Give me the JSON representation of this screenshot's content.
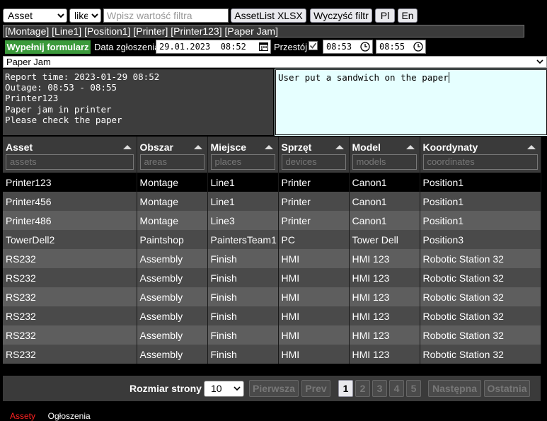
{
  "toolbar": {
    "field_select": "Asset",
    "operator_select": "like",
    "filter_placeholder": "Wpisz wartość filtra",
    "export_label": "AssetList XLSX",
    "clear_label": "Wyczyść filtr",
    "lang_pl": "Pl",
    "lang_en": "En"
  },
  "tags": "[Montage] [Line1] [Position1] [Printer] [Printer123] [Paper Jam]",
  "form": {
    "fill_label": "Wypełnij formularz",
    "date_label": "Data zgłoszenia",
    "date_value": "29.01.2023  08:52",
    "outage_label": "Przestój",
    "outage_checked": true,
    "time_from": "08:53",
    "time_to": "08:55",
    "issue_select": "Paper Jam"
  },
  "report": {
    "line1": "Report time: 2023-01-29 08:52",
    "line2": "Outage: 08:53 - 08:55",
    "line3": "Printer123",
    "line4": "Paper jam in printer",
    "line5": "Please check the paper"
  },
  "note": "User put a sandwich on the paper",
  "table": {
    "headers": [
      {
        "label": "Asset",
        "placeholder": "assets"
      },
      {
        "label": "Obszar",
        "placeholder": "areas"
      },
      {
        "label": "Miejsce",
        "placeholder": "places"
      },
      {
        "label": "Sprzęt",
        "placeholder": "devices"
      },
      {
        "label": "Model",
        "placeholder": "models"
      },
      {
        "label": "Koordynaty",
        "placeholder": "coordinates"
      }
    ],
    "rows": [
      [
        "Printer123",
        "Montage",
        "Line1",
        "Printer",
        "Canon1",
        "Position1"
      ],
      [
        "Printer456",
        "Montage",
        "Line1",
        "Printer",
        "Canon1",
        "Position1"
      ],
      [
        "Printer486",
        "Montage",
        "Line3",
        "Printer",
        "Canon1",
        "Position1"
      ],
      [
        "TowerDell2",
        "Paintshop",
        "PaintersTeam1",
        "PC",
        "Tower Dell",
        "Position3"
      ],
      [
        "RS232",
        "Assembly",
        "Finish",
        "HMI",
        "HMI 123",
        "Robotic Station 32"
      ],
      [
        "RS232",
        "Assembly",
        "Finish",
        "HMI",
        "HMI 123",
        "Robotic Station 32"
      ],
      [
        "RS232",
        "Assembly",
        "Finish",
        "HMI",
        "HMI 123",
        "Robotic Station 32"
      ],
      [
        "RS232",
        "Assembly",
        "Finish",
        "HMI",
        "HMI 123",
        "Robotic Station 32"
      ],
      [
        "RS232",
        "Assembly",
        "Finish",
        "HMI",
        "HMI 123",
        "Robotic Station 32"
      ],
      [
        "RS232",
        "Assembly",
        "Finish",
        "HMI",
        "HMI 123",
        "Robotic Station 32"
      ]
    ]
  },
  "pager": {
    "page_size_label": "Rozmiar strony",
    "page_size": "10",
    "first": "Pierwsza",
    "prev": "Prev",
    "pages": [
      "1",
      "2",
      "3",
      "4",
      "5"
    ],
    "next": "Następna",
    "last": "Ostatnia"
  },
  "footer": {
    "assets_link": "Assety",
    "announcements_link": "Ogłoszenia"
  },
  "colors": {
    "accent_green": "#3b9a3b",
    "active_link": "#ff2222",
    "note_bg": "#e6ffff"
  }
}
